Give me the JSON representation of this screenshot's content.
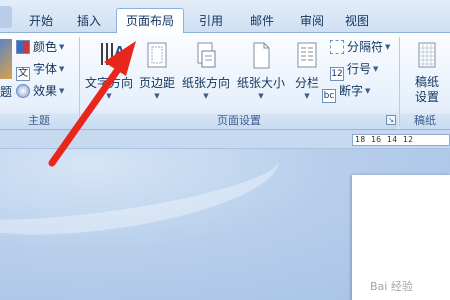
{
  "tabs": [
    {
      "label": "开始",
      "active": false
    },
    {
      "label": "插入",
      "active": false
    },
    {
      "label": "页面布局",
      "active": true
    },
    {
      "label": "引用",
      "active": false
    },
    {
      "label": "邮件",
      "active": false
    },
    {
      "label": "审阅",
      "active": false
    },
    {
      "label": "视图",
      "active": false
    }
  ],
  "theme_group": {
    "label": "主题",
    "big_label_partial": "题",
    "colors_label": "颜色",
    "fonts_label": "字体",
    "effects_label": "效果"
  },
  "page_setup_group": {
    "label": "页面设置",
    "text_direction": "文字方向",
    "margins": "页边距",
    "orientation": "纸张方向",
    "size": "纸张大小",
    "columns": "分栏",
    "breaks": "分隔符",
    "line_numbers": "行号",
    "hyphenation": "断字",
    "launcher_icon": "dialog-launcher-icon"
  },
  "draft_paper_group": {
    "label": "稿纸",
    "button_label_line1": "稿纸",
    "button_label_line2": "设置"
  },
  "ruler": {
    "text": "18  16  14  12"
  },
  "watermark": {
    "text": "Bai 经验"
  },
  "colors": {
    "accent_arrow": "#e8261c",
    "ribbon_border": "#8fb0d9"
  }
}
